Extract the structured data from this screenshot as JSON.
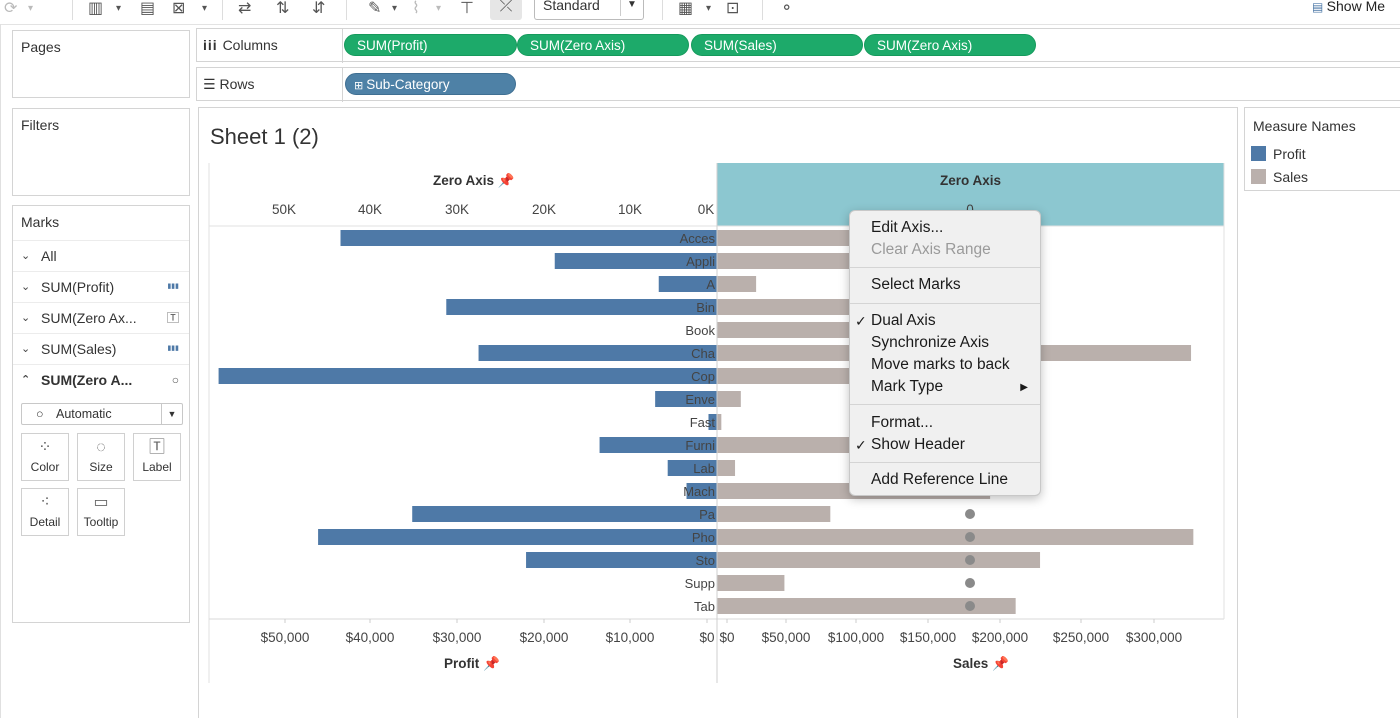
{
  "toolbar": {
    "view_size": "Standard",
    "show_me": "Show Me"
  },
  "pages": {
    "title": "Pages"
  },
  "filters": {
    "title": "Filters"
  },
  "columns_shelf": {
    "label": "Columns",
    "pills": [
      "SUM(Profit)",
      "SUM(Zero Axis)",
      "SUM(Sales)",
      "SUM(Zero Axis)"
    ]
  },
  "rows_shelf": {
    "label": "Rows",
    "pills": [
      "Sub-Category"
    ]
  },
  "marks": {
    "title": "Marks",
    "cards": [
      {
        "label": "All",
        "icon": ""
      },
      {
        "label": "SUM(Profit)",
        "icon": "bar-icon"
      },
      {
        "label": "SUM(Zero Ax...",
        "icon": "text-icon"
      },
      {
        "label": "SUM(Sales)",
        "icon": "bar-icon"
      },
      {
        "label": "SUM(Zero A...",
        "icon": "circle-icon"
      }
    ],
    "mark_type": "Automatic",
    "buttons": [
      "Color",
      "Size",
      "Label",
      "Detail",
      "Tooltip"
    ]
  },
  "sheet": {
    "title": "Sheet 1 (2)"
  },
  "legend": {
    "title": "Measure Names",
    "items": [
      {
        "label": "Profit",
        "color": "#4e79a7"
      },
      {
        "label": "Sales",
        "color": "#bab0ac"
      }
    ]
  },
  "context_menu": {
    "items": [
      {
        "label": "Edit Axis...",
        "enabled": true,
        "checked": false
      },
      {
        "label": "Clear Axis Range",
        "enabled": false,
        "checked": false
      },
      {
        "label": "Select Marks",
        "enabled": true,
        "checked": false
      },
      {
        "label": "Dual Axis",
        "enabled": true,
        "checked": true
      },
      {
        "label": "Synchronize Axis",
        "enabled": true,
        "checked": false
      },
      {
        "label": "Move marks to back",
        "enabled": true,
        "checked": false
      },
      {
        "label": "Mark Type",
        "enabled": true,
        "checked": false,
        "submenu": true
      },
      {
        "label": "Format...",
        "enabled": true,
        "checked": false
      },
      {
        "label": "Show Header",
        "enabled": true,
        "checked": true
      },
      {
        "label": "Add Reference Line",
        "enabled": true,
        "checked": false
      }
    ]
  },
  "chart_data": {
    "type": "bar",
    "categories": [
      "Acces",
      "Appli",
      "A",
      "Bin",
      "Book",
      "Cha",
      "Cop",
      "Enve",
      "Fast",
      "Furni",
      "Lab",
      "Mach",
      "Pa",
      "Pho",
      "Sto",
      "Supp",
      "Tab"
    ],
    "top_axes": {
      "left": {
        "title": "Zero Axis",
        "ticks": [
          "50K",
          "40K",
          "30K",
          "20K",
          "10K",
          "0K"
        ]
      },
      "right": {
        "title": "Zero Axis",
        "ticks": [
          "0"
        ],
        "highlighted": true
      }
    },
    "bottom_axes": {
      "left": {
        "title": "Profit",
        "ticks": [
          "$50,000",
          "$40,000",
          "$30,000",
          "$20,000",
          "$10,000",
          "$0"
        ]
      },
      "right": {
        "title": "Sales",
        "ticks": [
          "$0",
          "$50,000",
          "$100,000",
          "$150,000",
          "$200,000",
          "$250,000",
          "$300,000"
        ]
      }
    },
    "series": [
      {
        "name": "Profit",
        "color": "#4e79a7",
        "direction": "left",
        "xlim": [
          0,
          56000
        ],
        "values": [
          42000,
          18100,
          6500,
          30200,
          0,
          26600,
          55600,
          6900,
          950,
          13100,
          5500,
          3400,
          34000,
          44500,
          21300,
          0,
          0
        ]
      },
      {
        "name": "Sales",
        "color": "#bab0ac",
        "direction": "right",
        "xlim": [
          0,
          345000
        ],
        "values": [
          167000,
          107500,
          27100,
          203400,
          105000,
          328400,
          149500,
          16500,
          3000,
          91700,
          12500,
          189200,
          78500,
          330000,
          223800,
          46700,
          206900
        ]
      }
    ],
    "zero_axis_markers": {
      "value": 0,
      "categories_with_points": [
        "Pa",
        "Pho",
        "Sto",
        "Supp",
        "Tab"
      ]
    },
    "grid": false,
    "legend_position": "right"
  }
}
